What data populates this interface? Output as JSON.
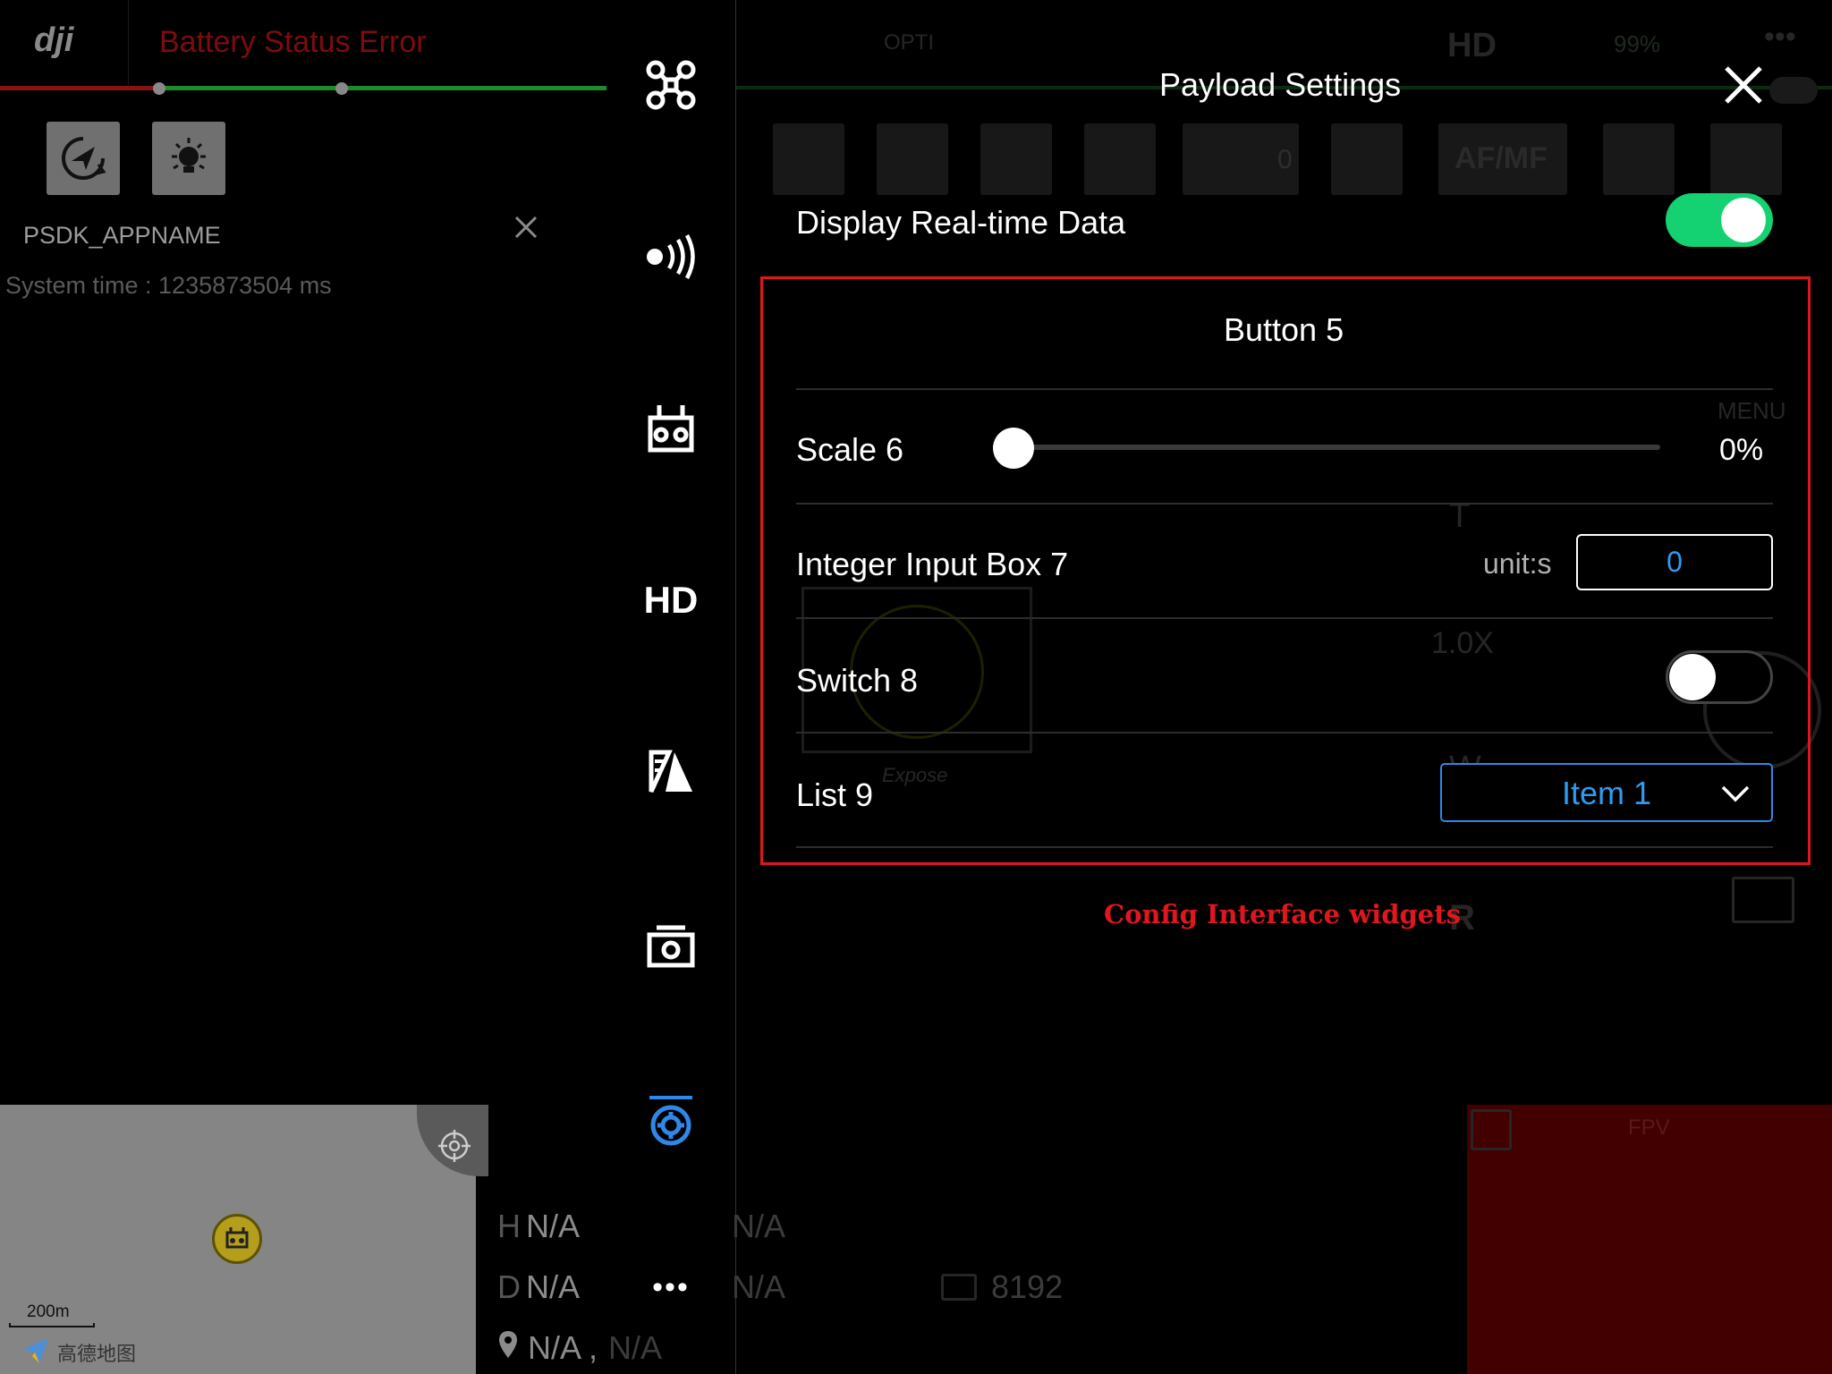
{
  "left_panel": {
    "logo": "dji",
    "battery_status": "Battery Status Error",
    "app_name": "PSDK_APPNAME",
    "system_time": "System time : 1235873504 ms",
    "quick_buttons": [
      "return-home-icon",
      "light-bulb-icon"
    ]
  },
  "map": {
    "scale": "200m",
    "brand": "高德地图"
  },
  "telemetry": {
    "h_label": "H",
    "h_value": "N/A",
    "d_label": "D",
    "d_value": "N/A",
    "loc_value": "N/A ,",
    "loc_value2": "N/A",
    "right_h": "N/A",
    "right_d": "N/A",
    "storage": "8192"
  },
  "side_icons": [
    "aircraft-icon",
    "signal-icon",
    "remote-controller-icon",
    "hd-icon",
    "battery-icon",
    "camera-icon",
    "settings-icon",
    "more-icon"
  ],
  "side_labels": {
    "hd": "HD",
    "more": "•••"
  },
  "background": {
    "opti_label": "OPTI",
    "hd_label": "HD",
    "battery_pct": "99%",
    "menu_label": "MENU",
    "zoom": "1.0X",
    "t_label": "T",
    "w_label": "W",
    "r_label": "R",
    "expose": "Expose",
    "af_mf": "AF/MF",
    "fpv": "FPV",
    "ev": "0"
  },
  "payload_settings": {
    "title": "Payload Settings",
    "realtime": {
      "label": "Display Real-time Data",
      "on": true
    },
    "button5": "Button 5",
    "scale6": {
      "label": "Scale 6",
      "value": "0%",
      "fraction": 0
    },
    "int7": {
      "label": "Integer Input Box 7",
      "unit": "unit:s",
      "value": "0"
    },
    "switch8": {
      "label": "Switch 8",
      "on": false
    },
    "list9": {
      "label": "List 9",
      "selected": "Item 1"
    },
    "caption": "Config Interface widgets"
  },
  "colors": {
    "accent_blue": "#2f9bf0",
    "toggle_green": "#14d272",
    "highlight_red": "#e0161f",
    "error_red": "#7d0d0d"
  }
}
